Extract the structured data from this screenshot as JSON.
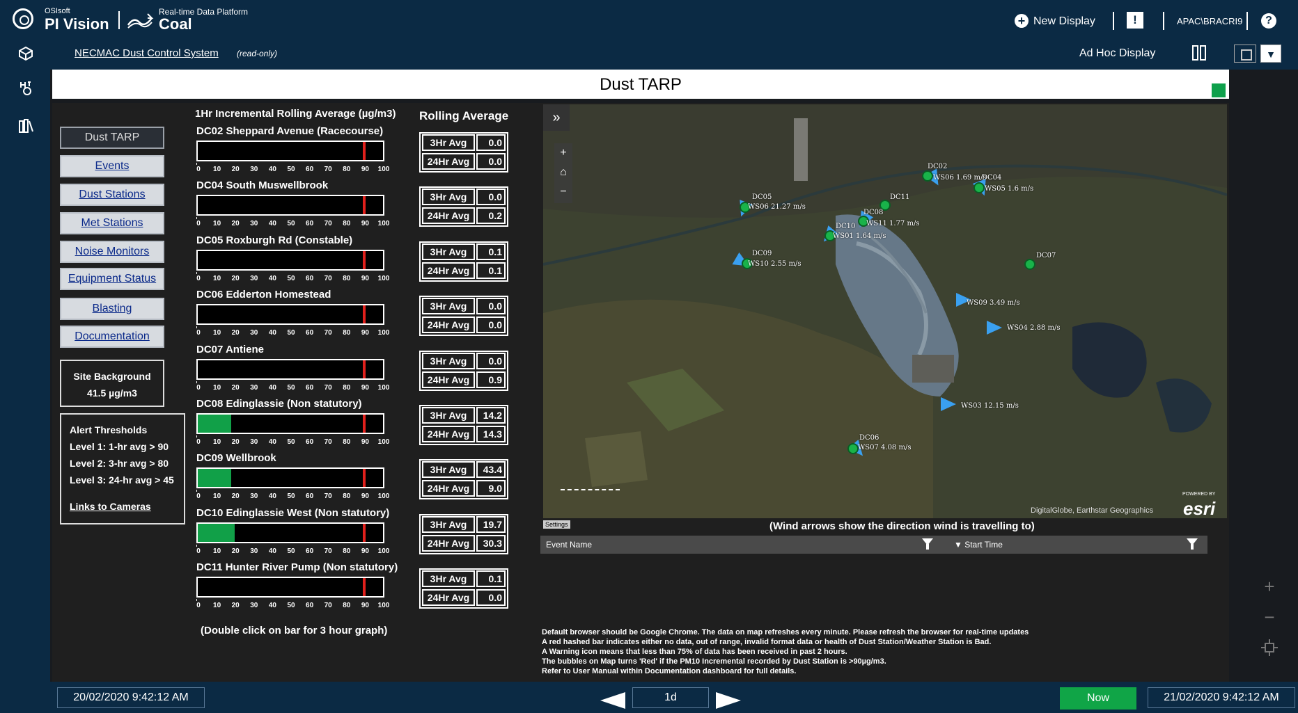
{
  "header": {
    "vendor": "OSIsoft",
    "product": "PI Vision",
    "platform_caption": "Real-time Data Platform",
    "platform_name": "Coal",
    "new_display": "New Display",
    "user": "APAC\\BRACRI9",
    "help": "?"
  },
  "subbar": {
    "display_name": "NECMAC Dust Control System",
    "mode": "(read-only)",
    "ad_hoc": "Ad Hoc Display"
  },
  "display": {
    "title": "Dust TARP",
    "status_color": "#0ea04b"
  },
  "nav": [
    {
      "label": "Dust TARP"
    },
    {
      "label": "Events"
    },
    {
      "label": "Dust Stations"
    },
    {
      "label": "Met Stations"
    },
    {
      "label": "Noise Monitors"
    },
    {
      "label": "Equipment Status"
    },
    {
      "label": "Blasting"
    },
    {
      "label": "Documentation"
    }
  ],
  "site_background": {
    "label": "Site Background",
    "value": "41.5 µg/m3"
  },
  "alert_thresholds": {
    "title": "Alert Thresholds",
    "level1": "Level 1: 1-hr avg > 90",
    "level2": "Level 2: 3-hr avg > 80",
    "level3": "Level 3: 24-hr avg > 45",
    "cameras": "Links to Cameras"
  },
  "bars_header": "1Hr Incremental Rolling Average (µg/m3)",
  "rolling_header": "Rolling Average",
  "scale_ticks": [
    "0",
    "10",
    "20",
    "30",
    "40",
    "50",
    "60",
    "70",
    "80",
    "90",
    "100"
  ],
  "stations": [
    {
      "id": "DC02",
      "name": "Sheppard Avenue (Racecourse)",
      "incr": 0,
      "avg3": "0.0",
      "avg24": "0.0"
    },
    {
      "id": "DC04",
      "name": "South Muswellbrook",
      "incr": 0,
      "avg3": "0.0",
      "avg24": "0.2"
    },
    {
      "id": "DC05",
      "name": "Roxburgh Rd (Constable)",
      "incr": 0,
      "avg3": "0.1",
      "avg24": "0.1"
    },
    {
      "id": "DC06",
      "name": "Edderton Homestead",
      "incr": 0,
      "avg3": "0.0",
      "avg24": "0.0"
    },
    {
      "id": "DC07",
      "name": "Antiene",
      "incr": 0,
      "avg3": "0.0",
      "avg24": "0.9"
    },
    {
      "id": "DC08",
      "name": "Edinglassie (Non statutory)",
      "incr": 18,
      "avg3": "14.2",
      "avg24": "14.3"
    },
    {
      "id": "DC09",
      "name": "Wellbrook",
      "incr": 18,
      "avg3": "43.4",
      "avg24": "9.0"
    },
    {
      "id": "DC10",
      "name": "Edinglassie West (Non statutory)",
      "incr": 20,
      "avg3": "19.7",
      "avg24": "30.3"
    },
    {
      "id": "DC11",
      "name": "Hunter River Pump (Non statutory)",
      "incr": 0,
      "avg3": "0.1",
      "avg24": "0.0"
    }
  ],
  "avg_labels": {
    "three": "3Hr Avg",
    "twentyfour": "24Hr Avg"
  },
  "threshold_value": 90,
  "double_click_note": "(Double click on bar for 3 hour graph)",
  "map": {
    "expand": "»",
    "zoom_in": "+",
    "home": "⌂",
    "zoom_out": "−",
    "attribution": "DigitalGlobe, Earthstar Geographics",
    "esri": "esri",
    "powered": "POWERED BY",
    "settings": "Settings",
    "wind_note": "(Wind arrows show the direction wind is travelling to)",
    "labels": [
      {
        "text": "DC02"
      },
      {
        "text": "WS06 1.69 m/s"
      },
      {
        "text": "DC04"
      },
      {
        "text": "WS05 1.6 m/s"
      },
      {
        "text": "DC05"
      },
      {
        "text": "WS06 21.27 m/s"
      },
      {
        "text": "DC11"
      },
      {
        "text": "DC08"
      },
      {
        "text": "WS11 1.77 m/s"
      },
      {
        "text": "DC10"
      },
      {
        "text": "WS01 1.64 m/s"
      },
      {
        "text": "DC09"
      },
      {
        "text": "WS10 2.55 m/s"
      },
      {
        "text": "DC07"
      },
      {
        "text": "WS09 3.49 m/s"
      },
      {
        "text": "WS04 2.88 m/s"
      },
      {
        "text": "WS03 12.15 m/s"
      },
      {
        "text": "DC06"
      },
      {
        "text": "WS07 4.08 m/s"
      }
    ]
  },
  "events_table": {
    "col1": "Event Name",
    "col2": "▼ Start Time"
  },
  "notes": [
    "Default browser should be Google Chrome. The data on map refreshes every minute. Please refresh the browser for real-time updates",
    "A red hashed bar indicates either no data, out of range, invalid format data or health of Dust Station/Weather Station is Bad.",
    "A Warning icon means that less than 75% of data has been received in past 2 hours.",
    "The bubbles on Map turns 'Red' if the PM10 Incremental recorded by Dust Station is >90µg/m3.",
    "Refer to User Manual within Documentation dashboard for full details."
  ],
  "timebar": {
    "start": "20/02/2020 9:42:12 AM",
    "duration": "1d",
    "now": "Now",
    "end": "21/02/2020 9:42:12 AM"
  },
  "colors": {
    "bar_fill": "#11a048",
    "threshold": "#e0201c",
    "header": "#0b2a44"
  }
}
